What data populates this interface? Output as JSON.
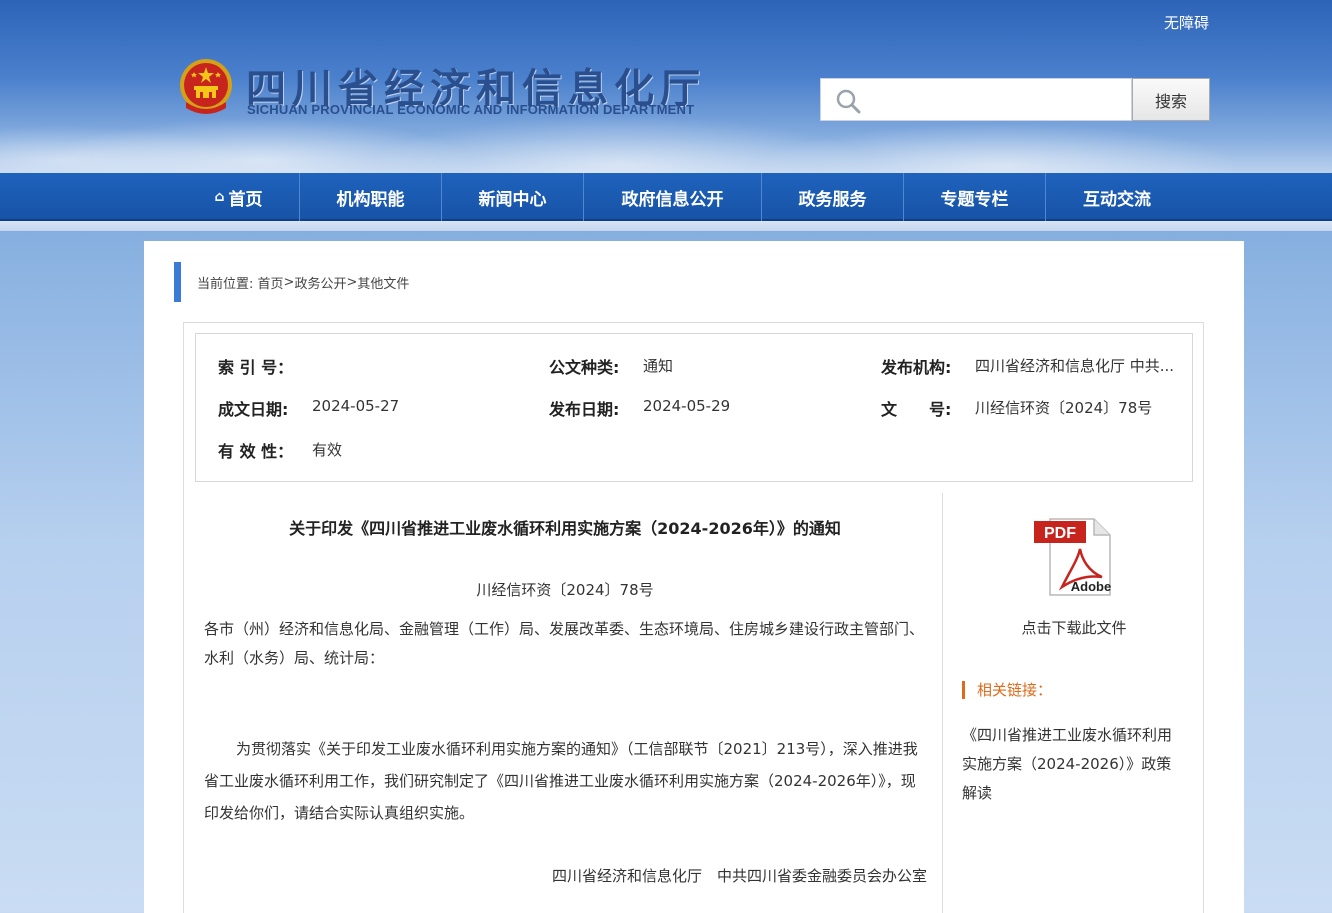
{
  "header": {
    "accessibility_label": "无障碍",
    "site_title": "四川省经济和信息化厅",
    "site_subtitle": "SICHUAN PROVINCIAL ECONOMIC AND INFORMATION DEPARTMENT",
    "search_placeholder": "",
    "search_button_label": "搜索"
  },
  "nav": {
    "items": [
      {
        "label": "首页",
        "icon": "home-icon"
      },
      {
        "label": "机构职能"
      },
      {
        "label": "新闻中心"
      },
      {
        "label": "政府信息公开"
      },
      {
        "label": "政务服务"
      },
      {
        "label": "专题专栏"
      },
      {
        "label": "互动交流"
      }
    ]
  },
  "breadcrumb": {
    "prefix": "当前位置:",
    "items": [
      "首页",
      "政务公开",
      "其他文件"
    ],
    "separator": ">"
  },
  "meta": {
    "index_label": "索 引 号：",
    "index_value": "",
    "doc_type_label": "公文种类:",
    "doc_type_value": "通知",
    "publisher_label": "发布机构:",
    "publisher_value": "四川省经济和信息化厅 中共...",
    "issue_date_label": "成文日期:",
    "issue_date_value": "2024-05-27",
    "publish_date_label": "发布日期:",
    "publish_date_value": "2024-05-29",
    "doc_number_label": "文　　号:",
    "doc_number_value": "川经信环资〔2024〕78号",
    "validity_label": "有 效 性：",
    "validity_value": "有效"
  },
  "article": {
    "title": "关于印发《四川省推进工业废水循环利用实施方案（2024-2026年）》的通知",
    "doc_number": "川经信环资〔2024〕78号",
    "recipients": "各市（州）经济和信息化局、金融管理（工作）局、发展改革委、生态环境局、住房城乡建设行政主管部门、水利（水务）局、统计局：",
    "body": "为贯彻落实《关于印发工业废水循环利用实施方案的通知》（工信部联节〔2021〕213号），深入推进我省工业废水循环利用工作，我们研究制定了《四川省推进工业废水循环利用实施方案（2024-2026年）》，现印发给你们，请结合实际认真组织实施。",
    "signature": "四川省经济和信息化厅　中共四川省委金融委员会办公室"
  },
  "sidebar": {
    "pdf_icon": "pdf-icon",
    "pdf_text_top": "PDF",
    "pdf_text_bottom": "Adobe",
    "download_label": "点击下载此文件",
    "related_heading": "相关链接：",
    "related_link": "《四川省推进工业废水循环利用实施方案（2024-2026）》政策解读"
  },
  "colors": {
    "nav_blue": "#1a5ab3",
    "accent_orange": "#e06a1b",
    "breadcrumb_bar": "#3a7bd5"
  }
}
